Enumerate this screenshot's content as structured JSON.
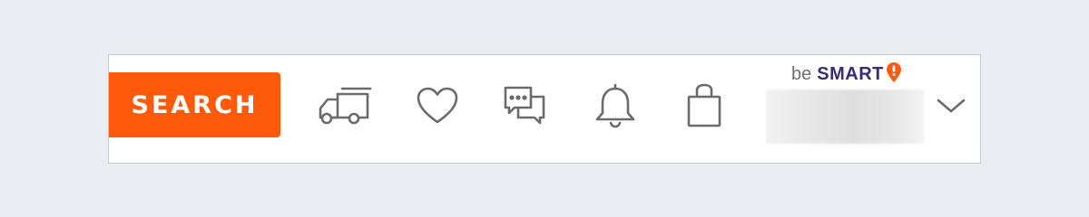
{
  "header": {
    "search_button_label": "SEARCH",
    "search_button_color": "#ff5a0a",
    "icons": [
      {
        "name": "delivery-truck-icon"
      },
      {
        "name": "heart-icon"
      },
      {
        "name": "chat-icon"
      },
      {
        "name": "bell-icon"
      },
      {
        "name": "shopping-bag-icon"
      }
    ],
    "promo": {
      "prefix": "be",
      "brand": "SMART",
      "brand_color": "#3b2a7a",
      "badge_icon": "exclamation-badge-icon",
      "badge_color": "#ff5a0a"
    },
    "account_menu_icon": "chevron-down-icon"
  }
}
